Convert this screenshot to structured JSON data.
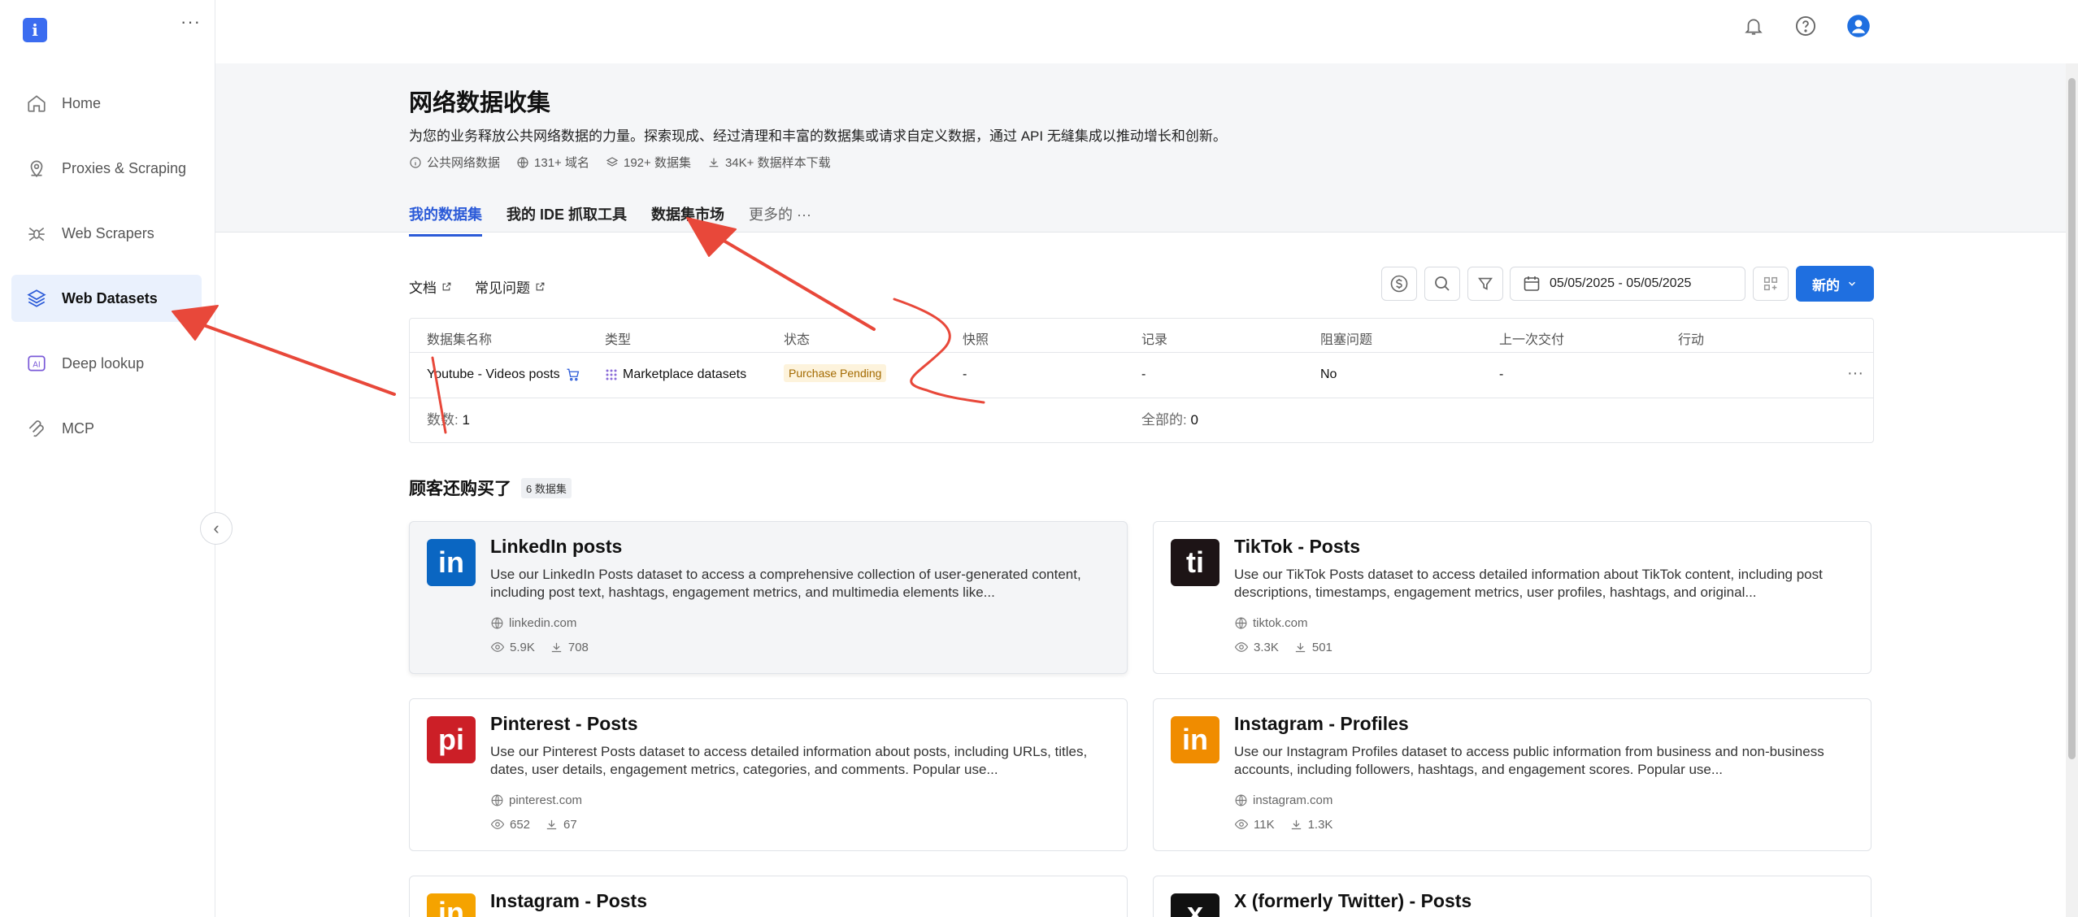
{
  "sidebar": {
    "logo_letter": "i",
    "menu_dots": "···",
    "items": [
      {
        "label": "Home",
        "icon": "home-icon"
      },
      {
        "label": "Proxies & Scraping",
        "icon": "location-pin-icon"
      },
      {
        "label": "Web Scrapers",
        "icon": "spider-icon"
      },
      {
        "label": "Web Datasets",
        "icon": "layers-icon",
        "active": true
      },
      {
        "label": "Deep lookup",
        "icon": "ai-icon"
      },
      {
        "label": "MCP",
        "icon": "mcp-icon"
      }
    ],
    "collapse_glyph": "‹"
  },
  "header": {
    "title": "网络数据收集",
    "subtitle": "为您的业务释放公共网络数据的力量。探索现成、经过清理和丰富的数据集或请求自定义数据，通过 API 无缝集成以推动增长和创新。",
    "stats": [
      "公共网络数据",
      "131+ 域名",
      "192+ 数据集",
      "34K+ 数据样本下载"
    ],
    "tabs": [
      "我的数据集",
      "我的 IDE 抓取工具",
      "数据集市场",
      "更多的"
    ],
    "more_dots": "···"
  },
  "toolbar": {
    "docs_label": "文档",
    "faq_label": "常见问题",
    "date_range": "05/05/2025 - 05/05/2025",
    "new_label": "新的"
  },
  "table": {
    "columns": [
      "数据集名称",
      "类型",
      "状态",
      "快照",
      "记录",
      "阻塞问题",
      "上一次交付",
      "行动"
    ],
    "rows": [
      {
        "name": "Youtube - Videos posts",
        "type": "Marketplace datasets",
        "status": "Purchase Pending",
        "snapshot": "-",
        "records": "-",
        "blocking": "No",
        "last_delivery": "-"
      }
    ],
    "footer_count_label": "数数:",
    "footer_count": "1",
    "footer_total_label": "全部的:",
    "footer_total": "0"
  },
  "section": {
    "title": "顾客还购买了",
    "count": "6 数据集"
  },
  "cards": [
    {
      "logo": "in",
      "color": "#0a66c2",
      "title": "LinkedIn posts",
      "desc": "Use our LinkedIn Posts dataset to access a comprehensive collection of user-generated content, including post text, hashtags, engagement metrics, and multimedia elements like...",
      "domain": "linkedin.com",
      "views": "5.9K",
      "downloads": "708"
    },
    {
      "logo": "ti",
      "color": "#1d1416",
      "title": "TikTok - Posts",
      "desc": "Use our TikTok Posts dataset to access detailed information about TikTok content, including post descriptions, timestamps, engagement metrics, user profiles, hashtags, and original...",
      "domain": "tiktok.com",
      "views": "3.3K",
      "downloads": "501"
    },
    {
      "logo": "pi",
      "color": "#cc1f27",
      "title": "Pinterest - Posts",
      "desc": "Use our Pinterest Posts dataset to access detailed information about posts, including URLs, titles, dates, user details, engagement metrics, categories, and comments. Popular use...",
      "domain": "pinterest.com",
      "views": "652",
      "downloads": "67"
    },
    {
      "logo": "in",
      "color": "#f08c00",
      "title": "Instagram - Profiles",
      "desc": "Use our Instagram Profiles dataset to access public information from business and non-business accounts, including followers, hashtags, and engagement scores. Popular use...",
      "domain": "instagram.com",
      "views": "11K",
      "downloads": "1.3K"
    },
    {
      "logo": "in",
      "color": "#f5a300",
      "title": "Instagram - Posts",
      "desc": "",
      "domain": "",
      "views": "",
      "downloads": ""
    },
    {
      "logo": "x",
      "color": "#111111",
      "title": "X (formerly Twitter) - Posts",
      "desc": "",
      "domain": "",
      "views": "",
      "downloads": ""
    }
  ],
  "colors": {
    "accent": "#2c5bd8",
    "primary_button": "#1f6fe0",
    "annotation": "#e8483a"
  }
}
